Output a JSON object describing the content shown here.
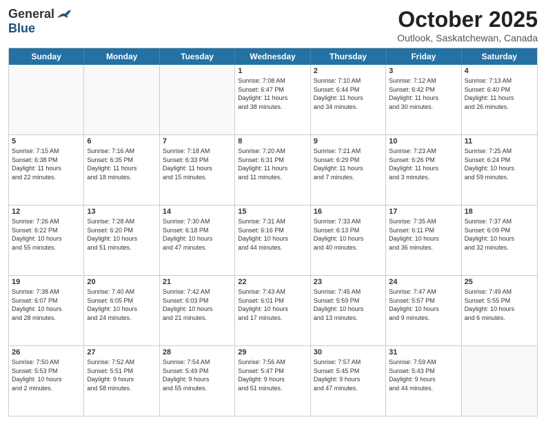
{
  "header": {
    "logo_general": "General",
    "logo_blue": "Blue",
    "title": "October 2025",
    "location": "Outlook, Saskatchewan, Canada"
  },
  "days_of_week": [
    "Sunday",
    "Monday",
    "Tuesday",
    "Wednesday",
    "Thursday",
    "Friday",
    "Saturday"
  ],
  "weeks": [
    [
      {
        "day": "",
        "info": ""
      },
      {
        "day": "",
        "info": ""
      },
      {
        "day": "",
        "info": ""
      },
      {
        "day": "1",
        "info": "Sunrise: 7:08 AM\nSunset: 6:47 PM\nDaylight: 11 hours\nand 38 minutes."
      },
      {
        "day": "2",
        "info": "Sunrise: 7:10 AM\nSunset: 6:44 PM\nDaylight: 11 hours\nand 34 minutes."
      },
      {
        "day": "3",
        "info": "Sunrise: 7:12 AM\nSunset: 6:42 PM\nDaylight: 11 hours\nand 30 minutes."
      },
      {
        "day": "4",
        "info": "Sunrise: 7:13 AM\nSunset: 6:40 PM\nDaylight: 11 hours\nand 26 minutes."
      }
    ],
    [
      {
        "day": "5",
        "info": "Sunrise: 7:15 AM\nSunset: 6:38 PM\nDaylight: 11 hours\nand 22 minutes."
      },
      {
        "day": "6",
        "info": "Sunrise: 7:16 AM\nSunset: 6:35 PM\nDaylight: 11 hours\nand 18 minutes."
      },
      {
        "day": "7",
        "info": "Sunrise: 7:18 AM\nSunset: 6:33 PM\nDaylight: 11 hours\nand 15 minutes."
      },
      {
        "day": "8",
        "info": "Sunrise: 7:20 AM\nSunset: 6:31 PM\nDaylight: 11 hours\nand 11 minutes."
      },
      {
        "day": "9",
        "info": "Sunrise: 7:21 AM\nSunset: 6:29 PM\nDaylight: 11 hours\nand 7 minutes."
      },
      {
        "day": "10",
        "info": "Sunrise: 7:23 AM\nSunset: 6:26 PM\nDaylight: 11 hours\nand 3 minutes."
      },
      {
        "day": "11",
        "info": "Sunrise: 7:25 AM\nSunset: 6:24 PM\nDaylight: 10 hours\nand 59 minutes."
      }
    ],
    [
      {
        "day": "12",
        "info": "Sunrise: 7:26 AM\nSunset: 6:22 PM\nDaylight: 10 hours\nand 55 minutes."
      },
      {
        "day": "13",
        "info": "Sunrise: 7:28 AM\nSunset: 6:20 PM\nDaylight: 10 hours\nand 51 minutes."
      },
      {
        "day": "14",
        "info": "Sunrise: 7:30 AM\nSunset: 6:18 PM\nDaylight: 10 hours\nand 47 minutes."
      },
      {
        "day": "15",
        "info": "Sunrise: 7:31 AM\nSunset: 6:16 PM\nDaylight: 10 hours\nand 44 minutes."
      },
      {
        "day": "16",
        "info": "Sunrise: 7:33 AM\nSunset: 6:13 PM\nDaylight: 10 hours\nand 40 minutes."
      },
      {
        "day": "17",
        "info": "Sunrise: 7:35 AM\nSunset: 6:11 PM\nDaylight: 10 hours\nand 36 minutes."
      },
      {
        "day": "18",
        "info": "Sunrise: 7:37 AM\nSunset: 6:09 PM\nDaylight: 10 hours\nand 32 minutes."
      }
    ],
    [
      {
        "day": "19",
        "info": "Sunrise: 7:38 AM\nSunset: 6:07 PM\nDaylight: 10 hours\nand 28 minutes."
      },
      {
        "day": "20",
        "info": "Sunrise: 7:40 AM\nSunset: 6:05 PM\nDaylight: 10 hours\nand 24 minutes."
      },
      {
        "day": "21",
        "info": "Sunrise: 7:42 AM\nSunset: 6:03 PM\nDaylight: 10 hours\nand 21 minutes."
      },
      {
        "day": "22",
        "info": "Sunrise: 7:43 AM\nSunset: 6:01 PM\nDaylight: 10 hours\nand 17 minutes."
      },
      {
        "day": "23",
        "info": "Sunrise: 7:45 AM\nSunset: 5:59 PM\nDaylight: 10 hours\nand 13 minutes."
      },
      {
        "day": "24",
        "info": "Sunrise: 7:47 AM\nSunset: 5:57 PM\nDaylight: 10 hours\nand 9 minutes."
      },
      {
        "day": "25",
        "info": "Sunrise: 7:49 AM\nSunset: 5:55 PM\nDaylight: 10 hours\nand 6 minutes."
      }
    ],
    [
      {
        "day": "26",
        "info": "Sunrise: 7:50 AM\nSunset: 5:53 PM\nDaylight: 10 hours\nand 2 minutes."
      },
      {
        "day": "27",
        "info": "Sunrise: 7:52 AM\nSunset: 5:51 PM\nDaylight: 9 hours\nand 58 minutes."
      },
      {
        "day": "28",
        "info": "Sunrise: 7:54 AM\nSunset: 5:49 PM\nDaylight: 9 hours\nand 55 minutes."
      },
      {
        "day": "29",
        "info": "Sunrise: 7:56 AM\nSunset: 5:47 PM\nDaylight: 9 hours\nand 51 minutes."
      },
      {
        "day": "30",
        "info": "Sunrise: 7:57 AM\nSunset: 5:45 PM\nDaylight: 9 hours\nand 47 minutes."
      },
      {
        "day": "31",
        "info": "Sunrise: 7:59 AM\nSunset: 5:43 PM\nDaylight: 9 hours\nand 44 minutes."
      },
      {
        "day": "",
        "info": ""
      }
    ]
  ]
}
